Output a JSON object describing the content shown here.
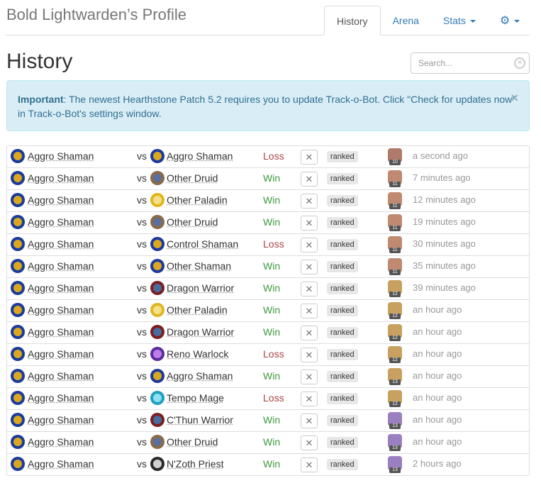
{
  "profile": {
    "title": "Bold Lightwarden’s Profile"
  },
  "nav": {
    "tabs": [
      {
        "label": "History",
        "active": true
      },
      {
        "label": "Arena",
        "active": false
      },
      {
        "label": "Stats",
        "active": false,
        "dropdown": true
      },
      {
        "icon": "gear-icon",
        "dropdown": true
      }
    ]
  },
  "page": {
    "title": "History"
  },
  "search": {
    "placeholder": "Search...",
    "value": ""
  },
  "alert": {
    "strong": "Important",
    "text": ": The newest Hearthstone Patch 5.2 requires you to update Track-o-Bot. Click \"Check for updates now\" in Track-o-Bot's settings window.",
    "close": "×"
  },
  "colors": {
    "link": "#337ab7",
    "win": "#3c9a3c",
    "loss": "#a94442",
    "alert_bg": "#d9edf7",
    "alert_text": "#31708f"
  },
  "games": [
    {
      "hero": "Aggro Shaman",
      "hero_class": "shaman",
      "vs": "vs",
      "opponent": "Aggro Shaman",
      "opp_class": "shaman",
      "result": "Loss",
      "mode": "ranked",
      "rank": "10",
      "rank_color": "#b07a6a",
      "time": "a second ago"
    },
    {
      "hero": "Aggro Shaman",
      "hero_class": "shaman",
      "vs": "vs",
      "opponent": "Other Druid",
      "opp_class": "druid",
      "result": "Win",
      "mode": "ranked",
      "rank": "11",
      "rank_color": "#c08a70",
      "time": "7 minutes ago"
    },
    {
      "hero": "Aggro Shaman",
      "hero_class": "shaman",
      "vs": "vs",
      "opponent": "Other Paladin",
      "opp_class": "paladin",
      "result": "Win",
      "mode": "ranked",
      "rank": "11",
      "rank_color": "#c08a70",
      "time": "12 minutes ago"
    },
    {
      "hero": "Aggro Shaman",
      "hero_class": "shaman",
      "vs": "vs",
      "opponent": "Other Druid",
      "opp_class": "druid",
      "result": "Win",
      "mode": "ranked",
      "rank": "11",
      "rank_color": "#c08a70",
      "time": "19 minutes ago"
    },
    {
      "hero": "Aggro Shaman",
      "hero_class": "shaman",
      "vs": "vs",
      "opponent": "Control Shaman",
      "opp_class": "shaman",
      "result": "Loss",
      "mode": "ranked",
      "rank": "11",
      "rank_color": "#c08a70",
      "time": "30 minutes ago"
    },
    {
      "hero": "Aggro Shaman",
      "hero_class": "shaman",
      "vs": "vs",
      "opponent": "Other Shaman",
      "opp_class": "shaman",
      "result": "Win",
      "mode": "ranked",
      "rank": "11",
      "rank_color": "#c08a70",
      "time": "35 minutes ago"
    },
    {
      "hero": "Aggro Shaman",
      "hero_class": "shaman",
      "vs": "vs",
      "opponent": "Dragon Warrior",
      "opp_class": "warrior",
      "result": "Win",
      "mode": "ranked",
      "rank": "12",
      "rank_color": "#c8a060",
      "time": "39 minutes ago"
    },
    {
      "hero": "Aggro Shaman",
      "hero_class": "shaman",
      "vs": "vs",
      "opponent": "Other Paladin",
      "opp_class": "paladin",
      "result": "Win",
      "mode": "ranked",
      "rank": "12",
      "rank_color": "#c8a060",
      "time": "an hour ago"
    },
    {
      "hero": "Aggro Shaman",
      "hero_class": "shaman",
      "vs": "vs",
      "opponent": "Dragon Warrior",
      "opp_class": "warrior",
      "result": "Win",
      "mode": "ranked",
      "rank": "12",
      "rank_color": "#c8a060",
      "time": "an hour ago"
    },
    {
      "hero": "Aggro Shaman",
      "hero_class": "shaman",
      "vs": "vs",
      "opponent": "Reno Warlock",
      "opp_class": "warlock",
      "result": "Loss",
      "mode": "ranked",
      "rank": "12",
      "rank_color": "#c8a060",
      "time": "an hour ago"
    },
    {
      "hero": "Aggro Shaman",
      "hero_class": "shaman",
      "vs": "vs",
      "opponent": "Aggro Shaman",
      "opp_class": "shaman",
      "result": "Win",
      "mode": "ranked",
      "rank": "13",
      "rank_color": "#c8a060",
      "time": "an hour ago"
    },
    {
      "hero": "Aggro Shaman",
      "hero_class": "shaman",
      "vs": "vs",
      "opponent": "Tempo Mage",
      "opp_class": "mage",
      "result": "Loss",
      "mode": "ranked",
      "rank": "12",
      "rank_color": "#c8a060",
      "time": "an hour ago"
    },
    {
      "hero": "Aggro Shaman",
      "hero_class": "shaman",
      "vs": "vs",
      "opponent": "C'Thun Warrior",
      "opp_class": "warrior",
      "result": "Win",
      "mode": "ranked",
      "rank": "13",
      "rank_color": "#9a80c0",
      "time": "an hour ago"
    },
    {
      "hero": "Aggro Shaman",
      "hero_class": "shaman",
      "vs": "vs",
      "opponent": "Other Druid",
      "opp_class": "druid",
      "result": "Win",
      "mode": "ranked",
      "rank": "13",
      "rank_color": "#9a80c0",
      "time": "an hour ago"
    },
    {
      "hero": "Aggro Shaman",
      "hero_class": "shaman",
      "vs": "vs",
      "opponent": "N'Zoth Priest",
      "opp_class": "priest",
      "result": "Win",
      "mode": "ranked",
      "rank": "13",
      "rank_color": "#9a80c0",
      "time": "2 hours ago"
    }
  ]
}
